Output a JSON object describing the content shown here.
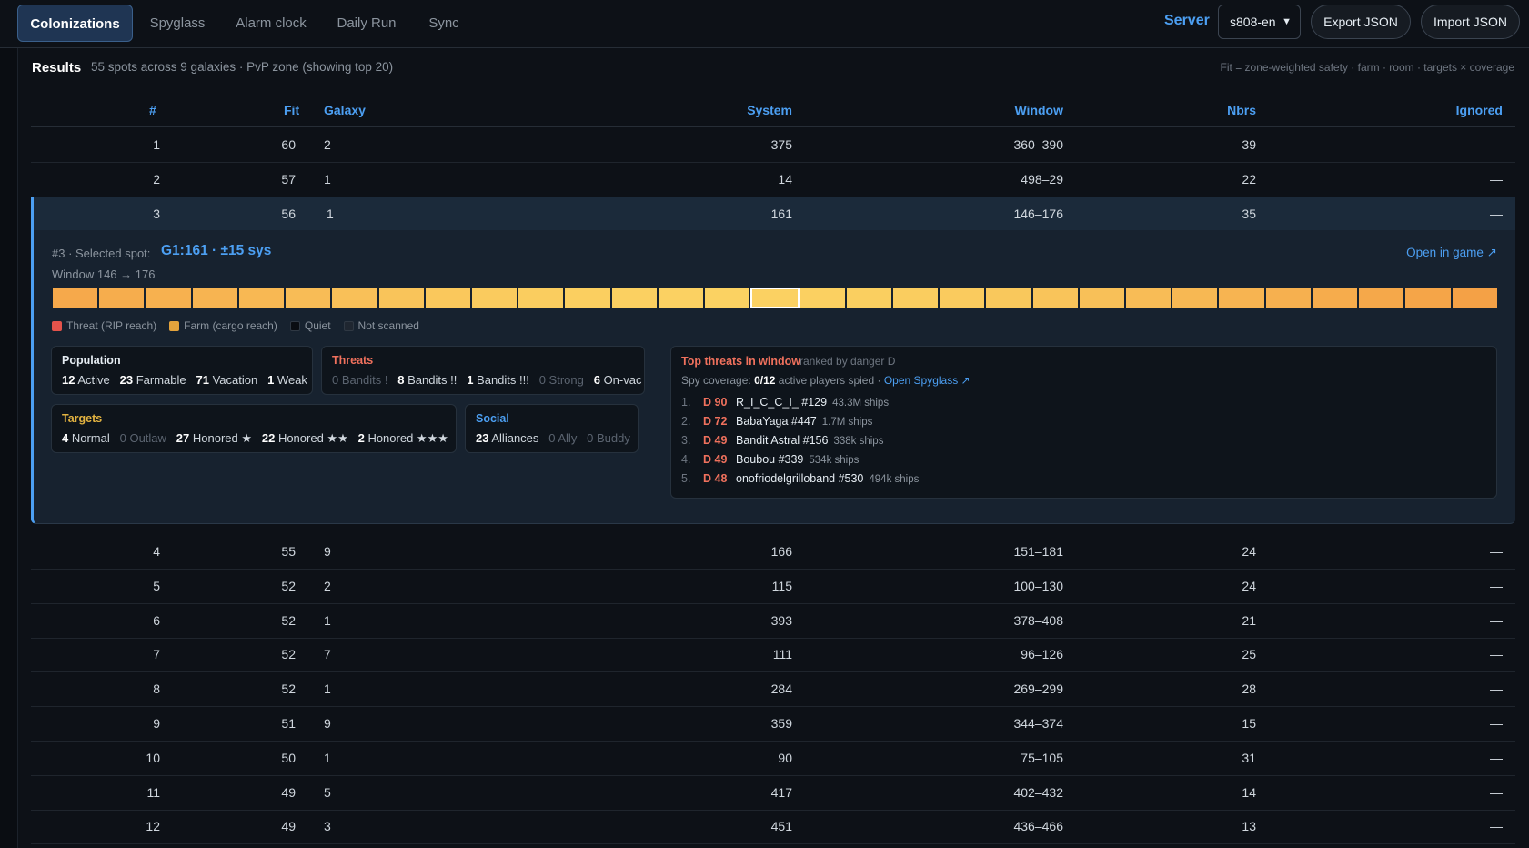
{
  "tabs": [
    {
      "label": "Colonizations",
      "active": true
    },
    {
      "label": "Spyglass",
      "active": false
    },
    {
      "label": "Alarm clock",
      "active": false
    },
    {
      "label": "Daily Run",
      "active": false
    },
    {
      "label": "Sync",
      "active": false
    }
  ],
  "server": {
    "label": "Server",
    "selected": "s808-en"
  },
  "buttons": {
    "export": "Export JSON",
    "import": "Import JSON"
  },
  "results": {
    "title": "Results",
    "summary": "55 spots across 9 galaxies · PvP zone (showing top 20)",
    "fit_note": "Fit = zone-weighted safety · farm · room · targets × coverage"
  },
  "table": {
    "headers": [
      "#",
      "Fit",
      "Galaxy",
      "System",
      "Window",
      "Nbrs",
      "Ignored"
    ],
    "rows_top": [
      {
        "rank": "1",
        "fit": "60",
        "galaxy": "2",
        "system": "375",
        "window": "360–390",
        "nbrs": "39",
        "ignored": "—"
      },
      {
        "rank": "2",
        "fit": "57",
        "galaxy": "1",
        "system": "14",
        "window": "498–29",
        "nbrs": "22",
        "ignored": "—"
      },
      {
        "rank": "3",
        "fit": "56",
        "galaxy": "1",
        "system": "161",
        "window": "146–176",
        "nbrs": "35",
        "ignored": "—"
      }
    ],
    "rows_bottom": [
      {
        "rank": "4",
        "fit": "55",
        "galaxy": "9",
        "system": "166",
        "window": "151–181",
        "nbrs": "24",
        "ignored": "—"
      },
      {
        "rank": "5",
        "fit": "52",
        "galaxy": "2",
        "system": "115",
        "window": "100–130",
        "nbrs": "24",
        "ignored": "—"
      },
      {
        "rank": "6",
        "fit": "52",
        "galaxy": "1",
        "system": "393",
        "window": "378–408",
        "nbrs": "21",
        "ignored": "—"
      },
      {
        "rank": "7",
        "fit": "52",
        "galaxy": "7",
        "system": "111",
        "window": "96–126",
        "nbrs": "25",
        "ignored": "—"
      },
      {
        "rank": "8",
        "fit": "52",
        "galaxy": "1",
        "system": "284",
        "window": "269–299",
        "nbrs": "28",
        "ignored": "—"
      },
      {
        "rank": "9",
        "fit": "51",
        "galaxy": "9",
        "system": "359",
        "window": "344–374",
        "nbrs": "15",
        "ignored": "—"
      },
      {
        "rank": "10",
        "fit": "50",
        "galaxy": "1",
        "system": "90",
        "window": "75–105",
        "nbrs": "31",
        "ignored": "—"
      },
      {
        "rank": "11",
        "fit": "49",
        "galaxy": "5",
        "system": "417",
        "window": "402–432",
        "nbrs": "14",
        "ignored": "—"
      },
      {
        "rank": "12",
        "fit": "49",
        "galaxy": "3",
        "system": "451",
        "window": "436–466",
        "nbrs": "13",
        "ignored": "—"
      }
    ]
  },
  "detail": {
    "prefix": "#3 · Selected spot:",
    "spot": "G1:161 · ±15 sys",
    "open_link": "Open in game ↗",
    "window": "Window 146 → 176",
    "heat_colors": [
      "#f6a94b",
      "#f6ad4d",
      "#f7b14f",
      "#f7b451",
      "#f8b853",
      "#f8bc56",
      "#f9c058",
      "#f9c45a",
      "#fac85c",
      "#facb5e",
      "#facd5f",
      "#fbcf60",
      "#fbd061",
      "#fbd162",
      "#fbd262",
      "#fbd162",
      "#fbd061",
      "#facf60",
      "#facd5f",
      "#facb5e",
      "#f9c85c",
      "#f9c45a",
      "#f8c058",
      "#f8bc56",
      "#f7b853",
      "#f7b451",
      "#f6b04f",
      "#f6ac4c",
      "#f5a84a",
      "#f5a548",
      "#f4a146"
    ],
    "heat_selected_index": 15,
    "legend": [
      {
        "label": "Threat (RIP reach)",
        "color": "#e5534b"
      },
      {
        "label": "Farm (cargo reach)",
        "color": "#e3a33c"
      },
      {
        "label": "Quiet",
        "color": "#0a0d12"
      },
      {
        "label": "Not scanned",
        "color": "#1f2630"
      }
    ],
    "population": {
      "title": "Population",
      "active_n": "12",
      "active_l": "Active",
      "farmable_n": "23",
      "farmable_l": "Farmable",
      "vacation_n": "71",
      "vacation_l": "Vacation",
      "weak_n": "1",
      "weak_l": "Weak"
    },
    "threats": {
      "title": "Threats",
      "b1": "0 Bandits !",
      "b2_n": "8",
      "b2_l": "Bandits !!",
      "b3_n": "1",
      "b3_l": "Bandits !!!",
      "strong": "0 Strong",
      "onvac_n": "6",
      "onvac_l": "On-vac"
    },
    "targets": {
      "title": "Targets",
      "normal_n": "4",
      "normal_l": "Normal",
      "outlaw": "0 Outlaw",
      "h1_n": "27",
      "h1_l": "Honored ★",
      "h2_n": "22",
      "h2_l": "Honored ★★",
      "h3_n": "2",
      "h3_l": "Honored ★★★"
    },
    "social": {
      "title": "Social",
      "alliances_n": "23",
      "alliances_l": "Alliances",
      "ally": "0 Ally",
      "buddy": "0 Buddy"
    },
    "top_threats": {
      "title": "Top threats in window",
      "note": "ranked by danger D",
      "coverage_label": "Spy coverage:",
      "coverage_value": "0/12",
      "coverage_suffix": "active players spied ·",
      "spyglass_link": "Open Spyglass ↗",
      "items": [
        {
          "n": "1.",
          "d": "D 90",
          "name": "R_I_C_C_I_ #129",
          "ships": "43.3M ships"
        },
        {
          "n": "2.",
          "d": "D 72",
          "name": "BabaYaga #447",
          "ships": "1.7M ships"
        },
        {
          "n": "3.",
          "d": "D 49",
          "name": "Bandit Astral #156",
          "ships": "338k ships"
        },
        {
          "n": "4.",
          "d": "D 49",
          "name": "Boubou #339",
          "ships": "534k ships"
        },
        {
          "n": "5.",
          "d": "D 48",
          "name": "onofriodelgrilloband #530",
          "ships": "494k ships"
        }
      ]
    }
  }
}
